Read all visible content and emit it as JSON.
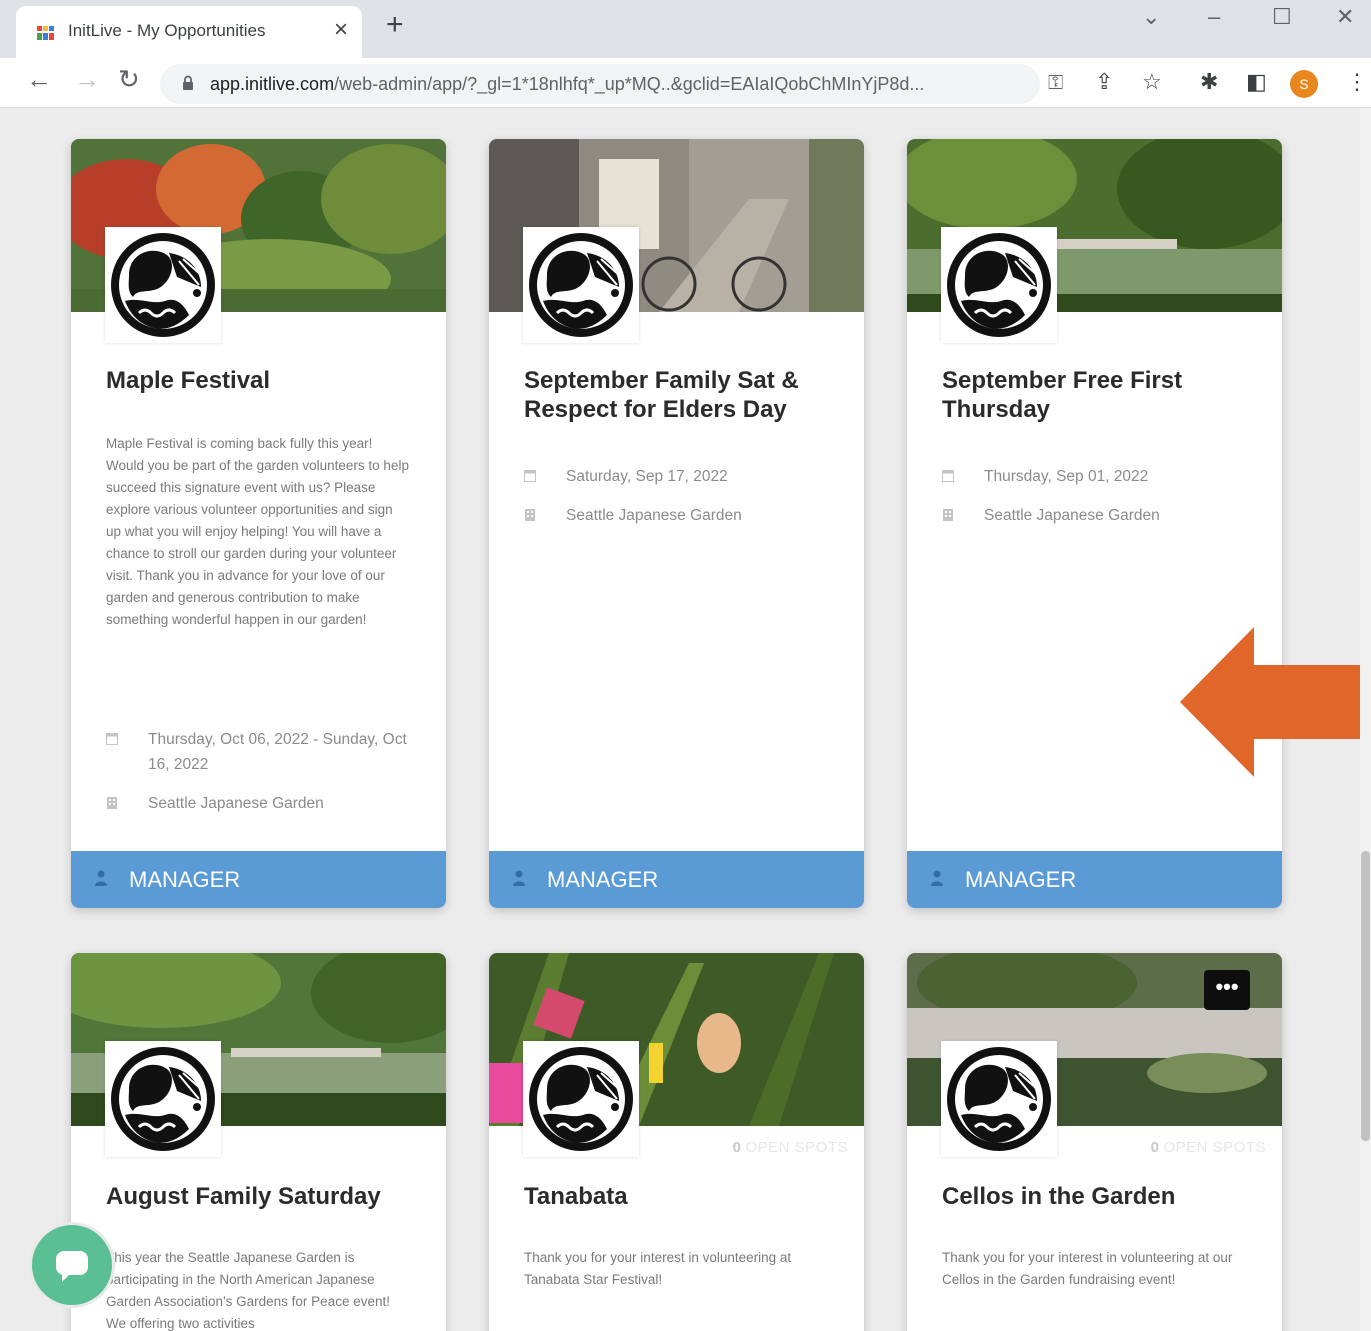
{
  "browser": {
    "tab_title": "InitLive - My Opportunities",
    "tab_close": "×",
    "new_tab": "+",
    "url_domain": "app.initlive.com",
    "url_path": "/web-admin/app/?_gl=1*18nlhfq*_up*MQ..&gclid=EAIaIQobChMInYjP8d...",
    "profile_initial": "S",
    "icons": [
      "back-icon",
      "forward-icon",
      "reload-icon",
      "lock-icon",
      "key-icon",
      "share-icon",
      "star-icon",
      "extensions-icon",
      "side-panel-icon",
      "menu-icon"
    ]
  },
  "cards": [
    {
      "title": "Maple Festival",
      "description": "Maple Festival is coming back fully this year! Would you be part of the garden volunteers to help succeed this signature event with us? Please explore various volunteer opportunities and sign up what you will enjoy helping! You will have a chance to stroll our garden during your volunteer visit. Thank you in advance for your love of our garden and generous contribution to make something wonderful happen in our garden!",
      "date": "Thursday, Oct 06, 2022 - Sunday, Oct 16, 2022",
      "location": "Seattle Japanese Garden",
      "role": "MANAGER"
    },
    {
      "title": "September Family Sat & Respect for Elders Day",
      "date": "Saturday, Sep 17, 2022",
      "location": "Seattle Japanese Garden",
      "role": "MANAGER"
    },
    {
      "title": "September Free First Thursday",
      "date": "Thursday, Sep 01, 2022",
      "location": "Seattle Japanese Garden",
      "role": "MANAGER"
    },
    {
      "title": "August Family Saturday",
      "description": "This year the Seattle Japanese Garden is participating in the North American Japanese Garden Association's Gardens for Peace event! We offering two activities"
    },
    {
      "title": "Tanabata",
      "open_spots_count": "0",
      "open_spots_label": "OPEN SPOTS",
      "description": "Thank you for your interest in volunteering at Tanabata Star Festival!"
    },
    {
      "title": "Cellos in the Garden",
      "open_spots_count": "0",
      "open_spots_label": "OPEN SPOTS",
      "description": "Thank you for your interest in volunteering at our Cellos in the Garden fundraising event!",
      "more_label": "•••"
    }
  ],
  "colors": {
    "footer_blue": "#5b9bd5",
    "arrow_orange": "#e0662a",
    "chat_green": "#5bbf96"
  }
}
